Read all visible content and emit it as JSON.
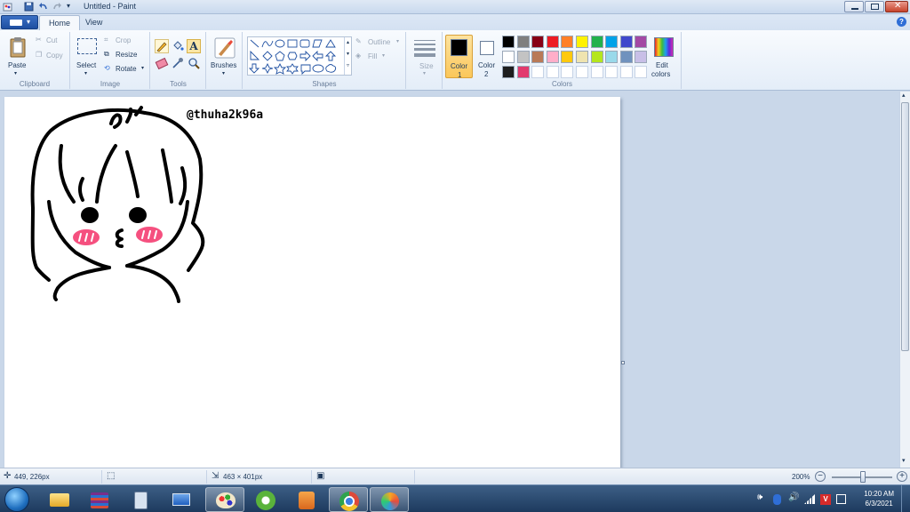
{
  "window": {
    "title": "Untitled - Paint"
  },
  "tabs": [
    {
      "label": "Home",
      "active": true
    },
    {
      "label": "View",
      "active": false
    }
  ],
  "ribbon": {
    "clipboard": {
      "paste": "Paste",
      "cut": "Cut",
      "copy": "Copy",
      "group": "Clipboard"
    },
    "image": {
      "select": "Select",
      "crop": "Crop",
      "resize": "Resize",
      "rotate": "Rotate",
      "group": "Image"
    },
    "tools": {
      "group": "Tools"
    },
    "brushes": {
      "label": "Brushes"
    },
    "shapes": {
      "outline": "Outline",
      "fill": "Fill",
      "group": "Shapes"
    },
    "size": {
      "label": "Size"
    },
    "color1": {
      "line1": "Color",
      "line2": "1"
    },
    "color2": {
      "line1": "Color",
      "line2": "2"
    },
    "colors": {
      "group": "Colors",
      "edit_line1": "Edit",
      "edit_line2": "colors"
    },
    "palette": [
      "#000000",
      "#7f7f7f",
      "#880015",
      "#ed1c24",
      "#ff7f27",
      "#fff200",
      "#22b14c",
      "#00a2e8",
      "#3f48cc",
      "#a349a4",
      "#ffffff",
      "#c3c3c3",
      "#b97a57",
      "#ffaec9",
      "#ffc90e",
      "#efe4b0",
      "#b5e61d",
      "#99d9ea",
      "#7092be",
      "#c8bfe7",
      "#1e1e1e",
      "#e23a6e",
      "#ffffff",
      "#ffffff",
      "#ffffff",
      "#ffffff",
      "#ffffff",
      "#ffffff",
      "#ffffff",
      "#ffffff"
    ]
  },
  "canvas": {
    "watermark_text": "@thuha2k96a",
    "stroke_color": "#000000",
    "blush_color": "#f5507f"
  },
  "status": {
    "cursor_pos": "449, 226px",
    "selection_size": "463 × 401px",
    "zoom": "200%"
  },
  "taskbar": {
    "time": "10:20 AM",
    "date": "6/3/2021"
  }
}
